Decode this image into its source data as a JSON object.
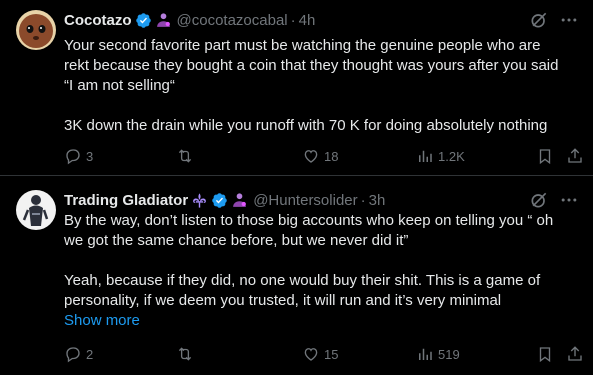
{
  "tweets": [
    {
      "name": "Cocotazo",
      "handle": "@cocotazocabal",
      "dot": "·",
      "time": "4h",
      "lines": [
        "Your second favorite part must be watching the genuine people who are",
        "rekt because they bought a coin that they thought was yours after you said",
        "“I am not selling“",
        "",
        "3K down the drain while you runoff with 70 K for doing absolutely nothing"
      ],
      "show_more": "",
      "replies": "3",
      "retweets": "",
      "likes": "18",
      "views": "1.2K"
    },
    {
      "name": "Trading Gladiator",
      "handle": "@Huntersolider",
      "dot": "·",
      "time": "3h",
      "lines": [
        "By the way, don’t listen to those big accounts who keep on telling you “ oh",
        "we got the same chance before, but we never did it”",
        "",
        "Yeah, because if they did, no one would buy their shit. This is a game of",
        "personality, if we deem you trusted, it will run and it’s very minimal"
      ],
      "show_more": "Show more",
      "replies": "2",
      "retweets": "",
      "likes": "15",
      "views": "519"
    }
  ],
  "colors": {
    "background": "#000000",
    "text": "#e7e9ea",
    "muted": "#71767b",
    "accent": "#1d9bf0",
    "verified": "#1d9bf0",
    "badge": "#b57edc",
    "divider": "#2f3336"
  },
  "icons": [
    "avatar",
    "verified-icon",
    "affiliate-badge-icon",
    "grok-icon",
    "more-icon",
    "reply-icon",
    "retweet-icon",
    "like-icon",
    "views-icon",
    "bookmark-icon",
    "share-icon"
  ]
}
